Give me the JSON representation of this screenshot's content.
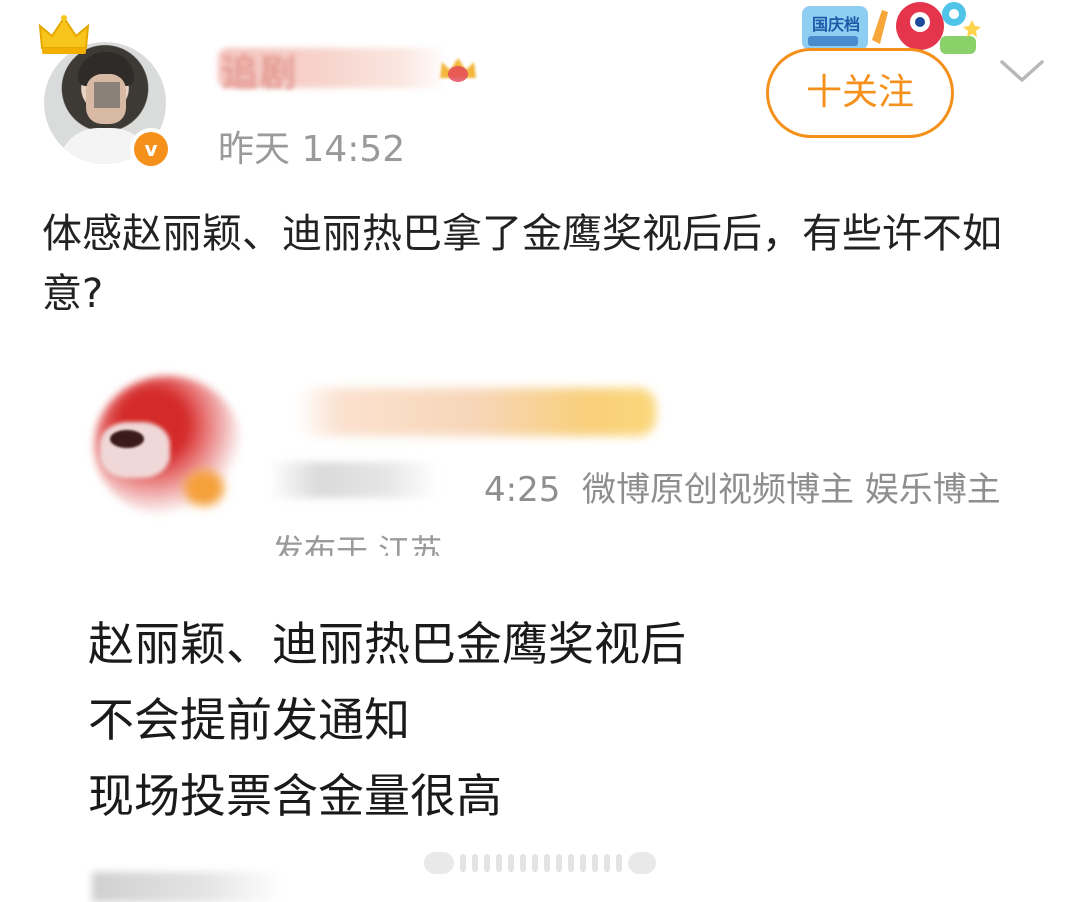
{
  "post": {
    "author_name": "追剧",
    "timestamp": "昨天 14:52",
    "follow_label": "十关注",
    "text": "体感赵丽颖、迪丽热巴拿了金鹰奖视后后，有些许不如意?"
  },
  "promo": {
    "label": "国庆档"
  },
  "embedded": {
    "time_fragment": "4:25",
    "roles": "微博原创视频博主 娱乐博主",
    "location": "发布于 江苏",
    "lines": [
      "赵丽颖、迪丽热巴金鹰奖视后",
      "不会提前发通知",
      "现场投票含金量很高"
    ]
  },
  "colors": {
    "accent": "#f5901b",
    "meta": "#9a9a9a",
    "text": "#222222"
  },
  "icons": {
    "crown": "crown-icon",
    "verified": "verified-badge-icon",
    "vip": "vip-badge-icon",
    "chevron": "chevron-down-icon"
  }
}
